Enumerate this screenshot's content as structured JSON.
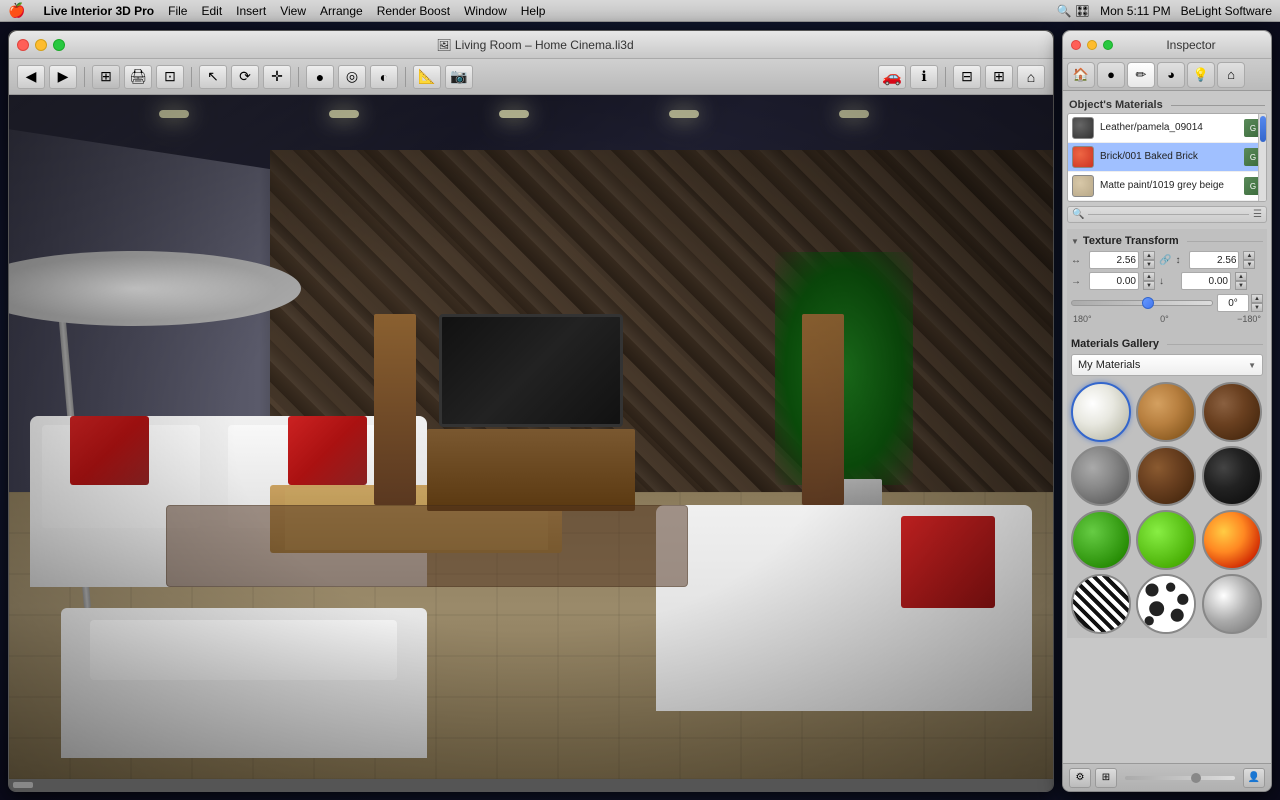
{
  "menubar": {
    "apple": "🍎",
    "items": [
      "Live Interior 3D Pro",
      "File",
      "Edit",
      "Insert",
      "View",
      "Arrange",
      "Render Boost",
      "Window",
      "Help"
    ],
    "right": {
      "time": "Mon 5:11 PM",
      "brand": "BeLight Software"
    }
  },
  "main_window": {
    "title": "Living Room – Home Cinema.li3d",
    "traffic_lights": {
      "close": "close",
      "minimize": "minimize",
      "maximize": "maximize"
    }
  },
  "inspector": {
    "title": "Inspector",
    "tabs": [
      "house-icon",
      "sphere-icon",
      "brush-icon",
      "material-ball-icon",
      "light-icon",
      "home-icon"
    ],
    "objects_materials_label": "Object's Materials",
    "materials": [
      {
        "name": "Leather/pamela_09014",
        "swatch_color": "#4a4a4a",
        "selected": false
      },
      {
        "name": "Brick/001 Baked Brick",
        "swatch_color": "#cc4422",
        "selected": true
      },
      {
        "name": "Matte paint/1019 grey beige",
        "swatch_color": "#c8b898",
        "selected": false
      }
    ],
    "texture_transform": {
      "label": "Texture Transform",
      "scale_x": "2.56",
      "scale_y": "2.56",
      "offset_x": "0.00",
      "offset_y": "0.00",
      "angle": "0°",
      "slider_min": "180°",
      "slider_mid": "0°",
      "slider_max": "−180°"
    },
    "materials_gallery": {
      "label": "Materials Gallery",
      "dropdown_value": "My Materials",
      "materials": [
        {
          "type": "white",
          "label": "White"
        },
        {
          "type": "wood",
          "label": "Wood"
        },
        {
          "type": "dark-wood",
          "label": "Dark Wood"
        },
        {
          "type": "stone",
          "label": "Stone"
        },
        {
          "type": "brown",
          "label": "Brown"
        },
        {
          "type": "black",
          "label": "Black"
        },
        {
          "type": "green",
          "label": "Green"
        },
        {
          "type": "bright-green",
          "label": "Bright Green"
        },
        {
          "type": "fire",
          "label": "Fire"
        },
        {
          "type": "zebra",
          "label": "Zebra"
        },
        {
          "type": "spots",
          "label": "Spots"
        },
        {
          "type": "silver",
          "label": "Silver"
        }
      ]
    }
  }
}
